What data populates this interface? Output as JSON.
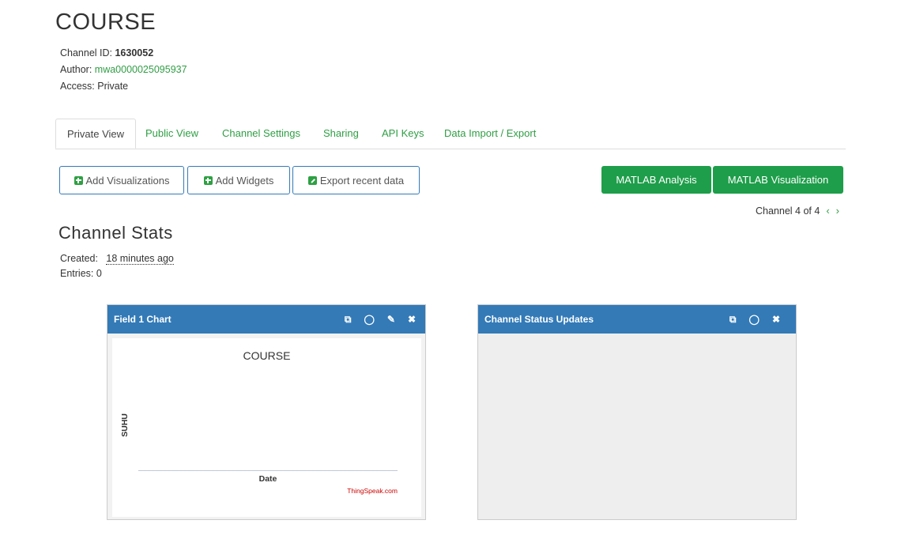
{
  "channel": {
    "title": "COURSE",
    "id_label": "Channel ID: ",
    "id_value": "1630052",
    "author_label": "Author: ",
    "author_value": "mwa0000025095937",
    "access": "Access: Private"
  },
  "tabs": [
    {
      "label": "Private View",
      "active": true
    },
    {
      "label": "Public View"
    },
    {
      "label": "Channel Settings"
    },
    {
      "label": "Sharing"
    },
    {
      "label": "API Keys"
    },
    {
      "label": "Data Import / Export"
    }
  ],
  "toolbar": {
    "add_visualizations": "Add Visualizations",
    "add_widgets": "Add Widgets",
    "export_recent": "Export recent data",
    "matlab_analysis": "MATLAB Analysis",
    "matlab_visualization": "MATLAB Visualization"
  },
  "pager": {
    "text": "Channel 4 of 4",
    "prev": "‹",
    "next": "›"
  },
  "stats": {
    "title": "Channel Stats",
    "created_label": "Created:",
    "created_value": "18 minutes ago",
    "entries": "Entries: 0"
  },
  "widgets": {
    "field_chart": {
      "header": "Field 1 Chart",
      "chart_title": "COURSE",
      "ylabel": "SUHU",
      "xlabel": "Date",
      "credit": "ThingSpeak.com"
    },
    "status_updates": {
      "header": "Channel Status Updates"
    }
  },
  "icons": {
    "open": "⧉",
    "comment": "◯",
    "edit": "✎",
    "close": "✖"
  },
  "colors": {
    "accent_green": "#2f9e44",
    "button_green": "#1e9e4a",
    "header_blue": "#337ab7"
  },
  "chart_data": {
    "type": "line",
    "title": "COURSE",
    "xlabel": "Date",
    "ylabel": "SUHU",
    "series": [
      {
        "values": []
      }
    ]
  }
}
